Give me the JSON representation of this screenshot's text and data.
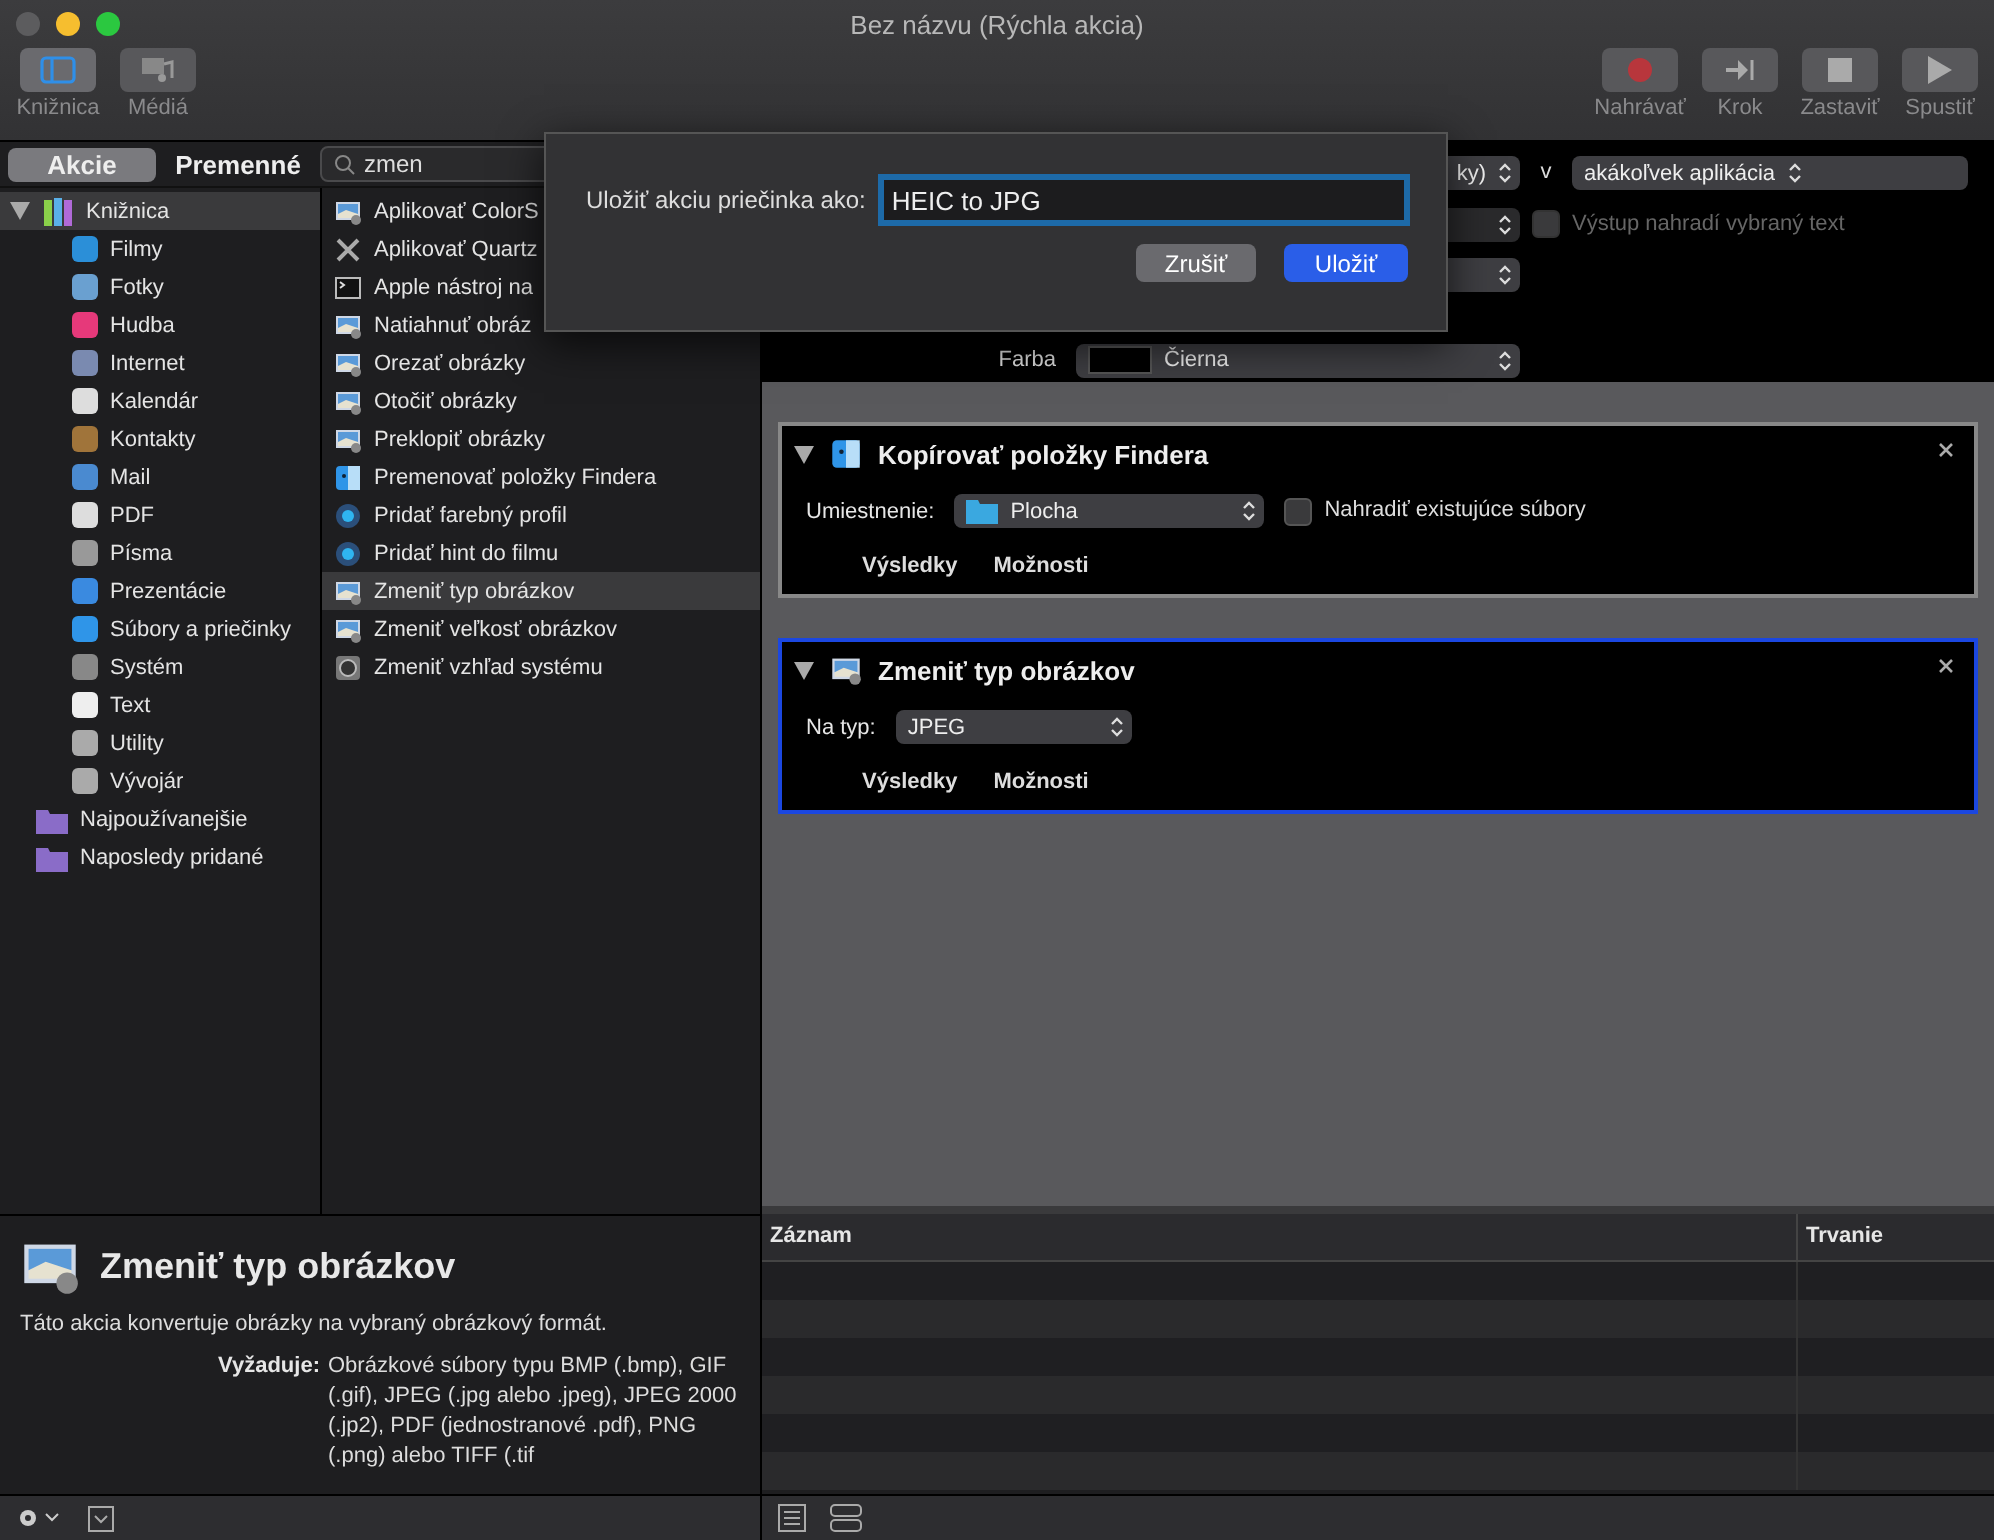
{
  "window": {
    "title": "Bez názvu (Rýchla akcia)"
  },
  "toolbar": {
    "left": [
      {
        "label": "Knižnica",
        "kind": "library",
        "selected": true
      },
      {
        "label": "Médiá",
        "kind": "media",
        "selected": false
      }
    ],
    "right": [
      {
        "label": "Nahrávať",
        "kind": "record"
      },
      {
        "label": "Krok",
        "kind": "step"
      },
      {
        "label": "Zastaviť",
        "kind": "stop"
      },
      {
        "label": "Spustiť",
        "kind": "run"
      }
    ]
  },
  "tabs": [
    {
      "label": "Akcie",
      "selected": true
    },
    {
      "label": "Premenné",
      "selected": false
    }
  ],
  "search": {
    "value": "zmen"
  },
  "library": [
    {
      "label": "Knižnica",
      "expanded": true,
      "selected": true,
      "children": [
        {
          "label": "Filmy"
        },
        {
          "label": "Fotky"
        },
        {
          "label": "Hudba"
        },
        {
          "label": "Internet"
        },
        {
          "label": "Kalendár"
        },
        {
          "label": "Kontakty"
        },
        {
          "label": "Mail"
        },
        {
          "label": "PDF"
        },
        {
          "label": "Písma"
        },
        {
          "label": "Prezentácie"
        },
        {
          "label": "Súbory a priečinky"
        },
        {
          "label": "Systém"
        },
        {
          "label": "Text"
        },
        {
          "label": "Utility"
        },
        {
          "label": "Vývojár"
        }
      ]
    },
    {
      "label": "Najpoužívanejšie",
      "selected": false
    },
    {
      "label": "Naposledy pridané",
      "selected": false
    }
  ],
  "actions": [
    {
      "label": "Aplikovať ColorS",
      "kind": "image",
      "selected": false
    },
    {
      "label": "Aplikovať Quartz",
      "kind": "tools",
      "selected": false
    },
    {
      "label": "Apple nástroj na",
      "kind": "terminal",
      "selected": false
    },
    {
      "label": "Natiahnuť obráz",
      "kind": "image",
      "selected": false
    },
    {
      "label": "Orezať obrázky",
      "kind": "image",
      "selected": false
    },
    {
      "label": "Otočiť obrázky",
      "kind": "image",
      "selected": false
    },
    {
      "label": "Preklopiť obrázky",
      "kind": "image",
      "selected": false
    },
    {
      "label": "Premenovať položky Findera",
      "kind": "finder",
      "selected": false
    },
    {
      "label": "Pridať farebný profil",
      "kind": "disc",
      "selected": false
    },
    {
      "label": "Pridať hint do filmu",
      "kind": "disc",
      "selected": false
    },
    {
      "label": "Zmeniť typ obrázkov",
      "kind": "image",
      "selected": true
    },
    {
      "label": "Zmeniť veľkosť obrázkov",
      "kind": "image",
      "selected": false
    },
    {
      "label": "Zmeniť vzhľad systému",
      "kind": "system",
      "selected": false
    }
  ],
  "description": {
    "title": "Zmeniť typ obrázkov",
    "text": "Táto akcia konvertuje obrázky na vybraný obrázkový formát.",
    "requires_label": "Vyžaduje:",
    "requires": "Obrázkové súbory typu BMP (.bmp), GIF (.gif), JPEG (.jpg alebo .jpeg), JPEG 2000 (.jp2), PDF (jednostranové .pdf), PNG (.png) alebo TIFF (.tif"
  },
  "workflow_header": [
    {
      "items": [
        {
          "kind": "popup",
          "value": "ky)"
        },
        {
          "kind": "label",
          "text": "v"
        },
        {
          "kind": "popup",
          "value": "akákoľvek aplikácia"
        }
      ]
    },
    {
      "items": [
        {
          "kind": "popup",
          "disabled": true
        },
        {
          "kind": "checkbox",
          "label": "Výstup nahradí vybraný text",
          "checked": false,
          "disabled": true
        }
      ]
    },
    {
      "items": [
        {
          "kind": "popup"
        }
      ]
    },
    {
      "items": [
        {
          "kind": "label",
          "text": "Farba"
        },
        {
          "kind": "swatch_popup",
          "value": "Čierna"
        }
      ]
    }
  ],
  "workflow": [
    {
      "title": "Kopírovať položky Findera",
      "kind": "finder",
      "selected": false,
      "field_label": "Umiestnenie:",
      "popup": {
        "value": "Plocha",
        "folder": true
      },
      "checkbox": {
        "label": "Nahradiť existujúce súbory",
        "checked": false
      },
      "tabs": [
        "Výsledky",
        "Možnosti"
      ]
    },
    {
      "title": "Zmeniť typ obrázkov",
      "kind": "image",
      "selected": true,
      "field_label": "Na typ:",
      "popup": {
        "value": "JPEG",
        "folder": false
      },
      "tabs": [
        "Výsledky",
        "Možnosti"
      ]
    }
  ],
  "log": {
    "columns": [
      "Záznam",
      "Trvanie"
    ]
  },
  "dialog": {
    "label": "Uložiť akciu priečinka ako:",
    "value": "HEIC to JPG",
    "buttons": [
      {
        "label": "Zrušiť",
        "default": false
      },
      {
        "label": "Uložiť",
        "default": true
      }
    ]
  }
}
